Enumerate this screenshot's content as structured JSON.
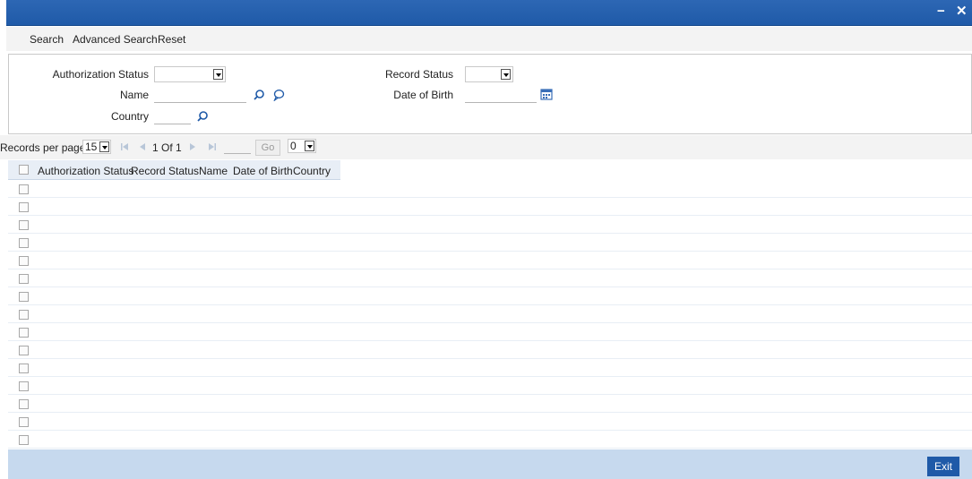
{
  "window": {
    "minimize": "−",
    "close": "✕"
  },
  "toolbar": {
    "search": "Search",
    "advanced_search": "Advanced Search",
    "reset": "Reset"
  },
  "form": {
    "authorization_status_label": "Authorization Status",
    "name_label": "Name",
    "country_label": "Country",
    "record_status_label": "Record Status",
    "date_of_birth_label": "Date of Birth",
    "authorization_status_value": "",
    "record_status_value": "",
    "name_value": "",
    "country_value": "",
    "date_of_birth_value": ""
  },
  "pager": {
    "records_per_page_label": "Records per page",
    "records_per_page_value": "15",
    "page_indicator": "1 Of 1",
    "go_label": "Go",
    "page_select_value": "0"
  },
  "grid": {
    "columns": [
      "Authorization Status",
      "Record Status",
      "Name",
      "Date of Birth",
      "Country"
    ],
    "row_count": 15
  },
  "footer": {
    "exit_label": "Exit"
  },
  "colors": {
    "titlebar": "#1f5aa8",
    "footer": "#c6d9ee",
    "exit_button": "#1f5aa8",
    "header_bg": "#e8eef6"
  },
  "icons": [
    "search-icon",
    "comment-icon",
    "calendar-icon",
    "first-page-icon",
    "prev-page-icon",
    "next-page-icon",
    "last-page-icon"
  ]
}
